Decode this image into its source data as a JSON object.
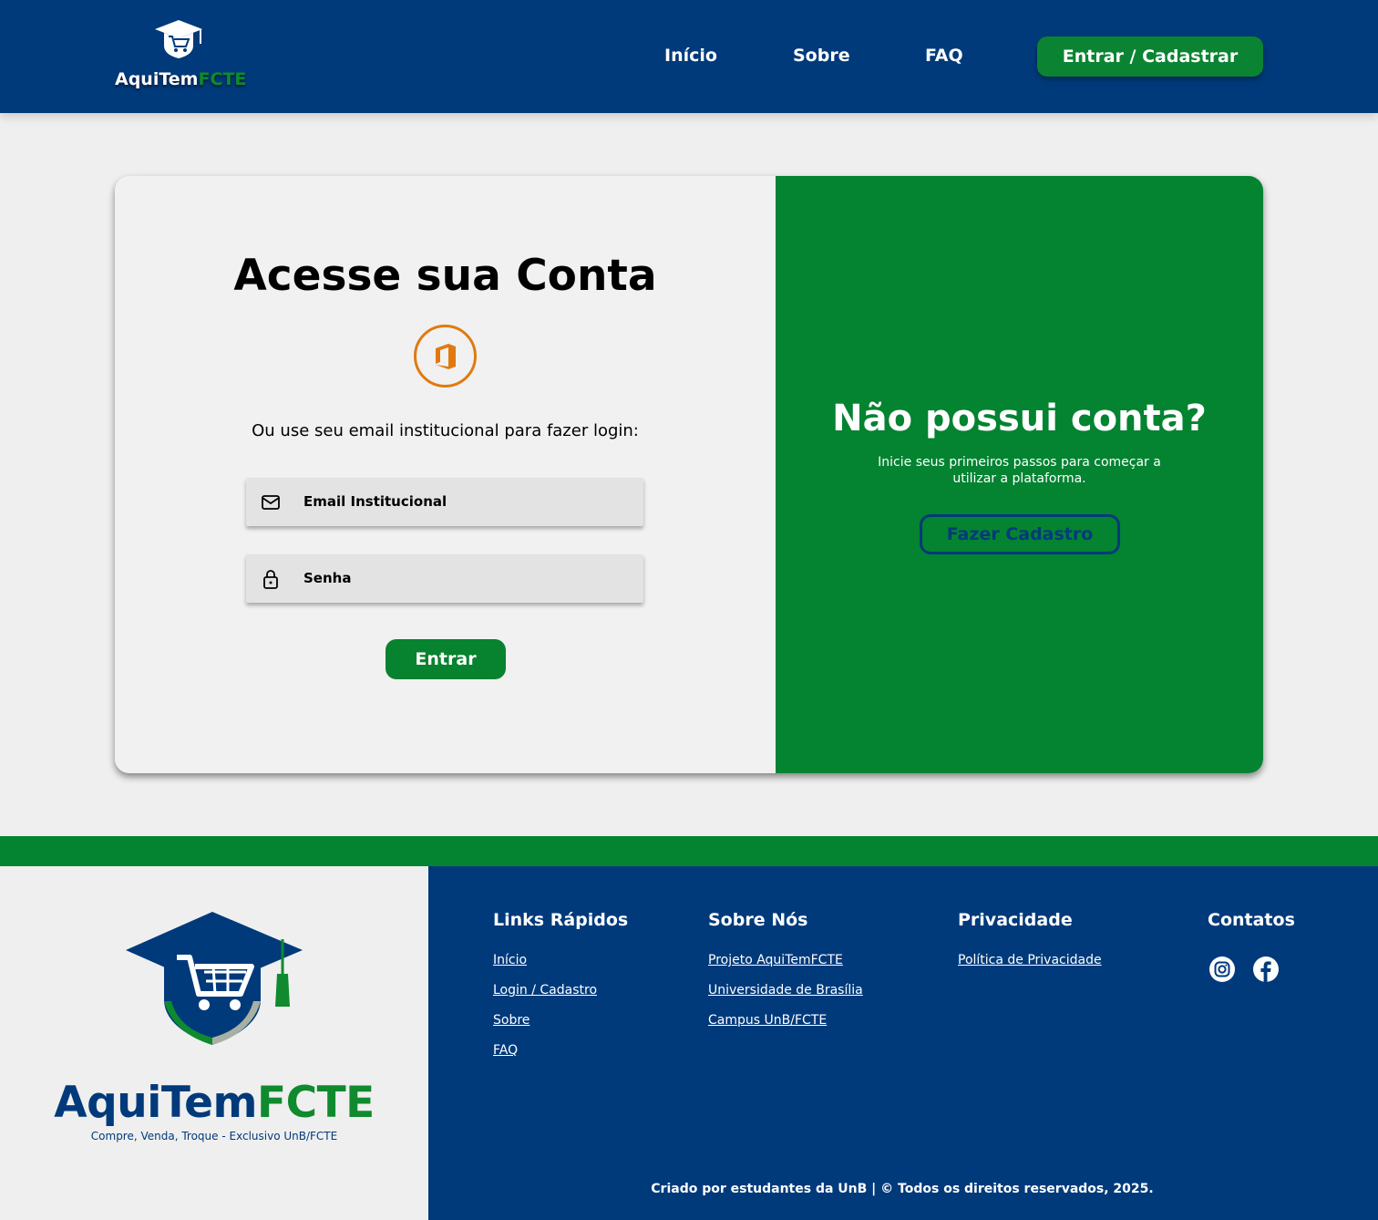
{
  "header": {
    "brand_main": "AquiTem",
    "brand_accent": "FCTE",
    "nav": [
      "Início",
      "Sobre",
      "FAQ"
    ],
    "cta": "Entrar / Cadastrar"
  },
  "login": {
    "title": "Acesse sua Conta",
    "subtitle": "Ou use seu email institucional para fazer login:",
    "email_label": "Email Institucional",
    "password_label": "Senha",
    "submit": "Entrar"
  },
  "signup": {
    "title": "Não possui conta?",
    "subtitle": "Inicie seus primeiros passos para começar a utilizar a plataforma.",
    "button": "Fazer Cadastro"
  },
  "footer": {
    "brand_main": "AquiTem",
    "brand_accent": "FCTE",
    "tagline": "Compre, Venda, Troque - Exclusivo UnB/FCTE",
    "columns": [
      {
        "title": "Links Rápidos",
        "links": [
          "Início",
          "Login / Cadastro",
          "Sobre",
          "FAQ"
        ]
      },
      {
        "title": "Sobre Nós",
        "links": [
          "Projeto AquiTemFCTE",
          "Universidade de Brasília",
          "Campus UnB/FCTE"
        ]
      },
      {
        "title": "Privacidade",
        "links": [
          "Política de Privacidade"
        ]
      },
      {
        "title": "Contatos",
        "links": []
      }
    ],
    "socials": [
      "instagram-icon",
      "facebook-icon"
    ],
    "copyright": "Criado por estudantes da UnB | © Todos os direitos reservados, 2025."
  },
  "colors": {
    "primary_blue": "#003a7b",
    "primary_green": "#048331",
    "office_orange": "#e07a10",
    "background": "#efefef"
  }
}
